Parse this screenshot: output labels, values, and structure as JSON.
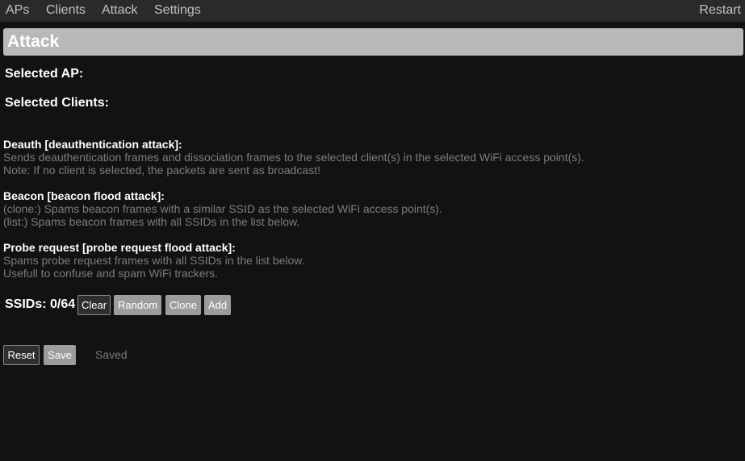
{
  "nav": {
    "aps": "APs",
    "clients": "Clients",
    "attack": "Attack",
    "settings": "Settings",
    "restart": "Restart"
  },
  "page": {
    "title": "Attack"
  },
  "selection": {
    "ap_label": "Selected AP:",
    "clients_label": "Selected Clients:"
  },
  "attacks": {
    "deauth": {
      "title": "Deauth [deauthentication attack]:",
      "line1": "Sends deauthentication frames and dissociation frames to the selected client(s) in the selected WiFi access point(s).",
      "line2": "Note: If no client is selected, the packets are sent as broadcast!"
    },
    "beacon": {
      "title": "Beacon [beacon flood attack]:",
      "line1": "(clone:) Spams beacon frames with a similar SSID as the selected WiFi access point(s).",
      "line2": "(list:) Spams beacon frames with all SSIDs in the list below."
    },
    "probe": {
      "title": "Probe request [probe request flood attack]:",
      "line1": "Spams probe request frames with all SSIDs in the list below.",
      "line2": "Usefull to confuse and spam WiFi trackers."
    }
  },
  "ssids": {
    "label": "SSIDs: 0/64",
    "clear": "Clear",
    "random": "Random",
    "clone": "Clone",
    "add": "Add"
  },
  "footer": {
    "reset": "Reset",
    "save": "Save",
    "status": "Saved"
  }
}
